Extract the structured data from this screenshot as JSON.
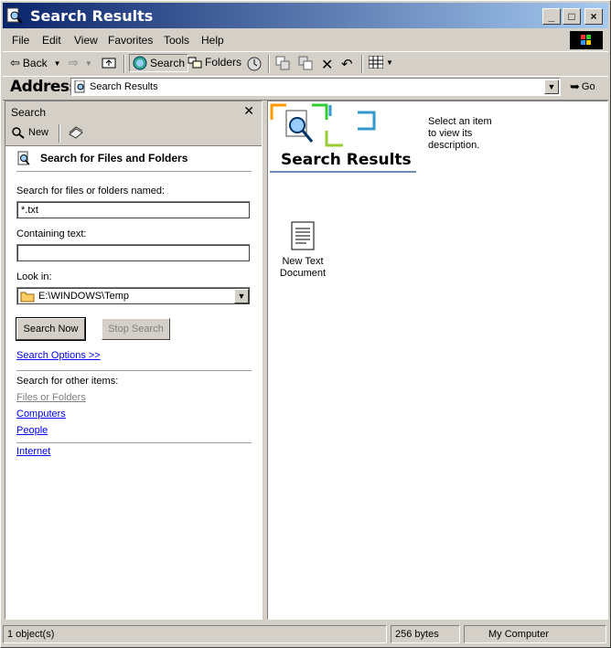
{
  "window": {
    "title": "Search Results"
  },
  "menu": [
    "File",
    "Edit",
    "View",
    "Favorites",
    "Tools",
    "Help"
  ],
  "toolbar": {
    "back": "Back",
    "search": "Search",
    "folders": "Folders"
  },
  "address": {
    "label": "Address",
    "value": "Search Results",
    "go": "Go"
  },
  "search_pane": {
    "title": "Search",
    "new_label": "New",
    "heading": "Search for Files and Folders",
    "named_label": "Search for files or folders named:",
    "named_value": "*.txt",
    "containing_label": "Containing text:",
    "containing_value": "",
    "look_in_label": "Look in:",
    "look_in_value": "E:\\WINDOWS\\Temp",
    "search_now": "Search Now",
    "stop_search": "Stop Search",
    "options_link": "Search Options >>",
    "other_label": "Search for other items:",
    "other_items": [
      "Files or Folders",
      "Computers",
      "People"
    ],
    "internet": "Internet"
  },
  "content": {
    "title": "Search Results",
    "hint": "Select an item to view its description.",
    "file_line1": "New Text",
    "file_line2": "Document"
  },
  "status": {
    "objects": "1 object(s)",
    "size": "256 bytes",
    "zone": "My Computer"
  }
}
